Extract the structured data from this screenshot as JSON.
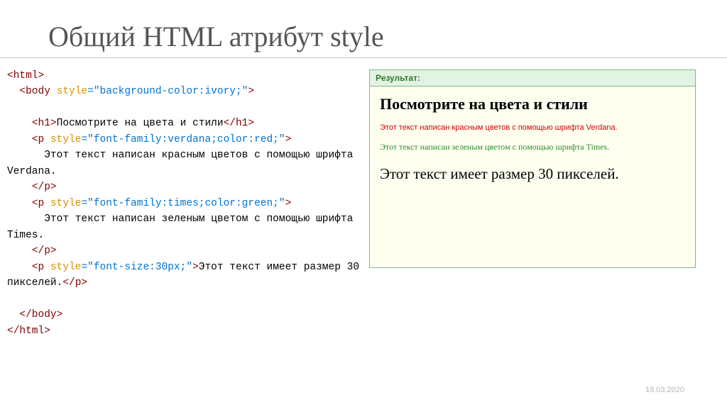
{
  "title": "Общий HTML атрибут style",
  "code": {
    "tag_html_open": "<html>",
    "tag_body_open_1": "<body",
    "attr_style": " style",
    "body_style_val": "=\"background-color:ivory;\"",
    "tag_close": ">",
    "tag_h1_open": "<h1>",
    "h1_text": "Посмотрите на цвета и стили",
    "tag_h1_close": "</h1>",
    "tag_p_open": "<p",
    "p1_style_val": "=\"font-family:verdana;color:red;\"",
    "p1_text": "      Этот текст написан красным цветов с помощью шрифта Verdana.",
    "tag_p_close": "</p>",
    "p2_style_val": "=\"font-family:times;color:green;\"",
    "p2_text": "      Этот текст написан зеленым цветом с помощью шрифта Times.",
    "p3_style_val": "=\"font-size:30px;\"",
    "p3_text": "Этот текст имеет размер 30 пикселей.",
    "tag_body_close": "</body>",
    "tag_html_close": "</html>"
  },
  "result": {
    "header": "Результат:",
    "h1": "Посмотрите на цвета и стили",
    "p1": "Этот текст написан красным цветов с помощью шрифта Verdana.",
    "p2": "Этот текст написан зеленым цветом с помощью шрифта Times.",
    "p3": "Этот текст имеет размер 30 пикселей."
  },
  "footer_date": "19.03.2020"
}
